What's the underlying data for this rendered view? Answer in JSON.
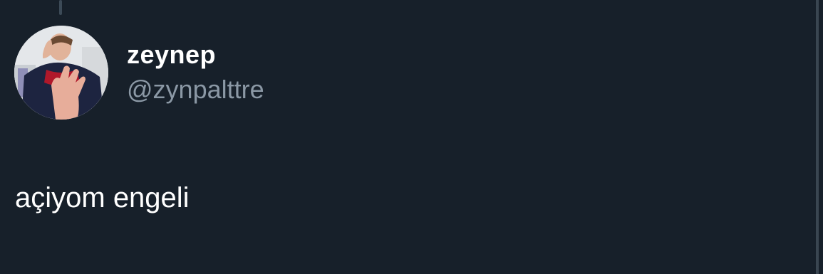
{
  "tweet": {
    "author": {
      "display_name": "zeynep",
      "handle": "@zynpalttre"
    },
    "text": "açiyom engeli"
  },
  "colors": {
    "background": "#17202a",
    "name_text": "#ffffff",
    "handle_text": "#8b98a5",
    "thread_line": "#3c4a57"
  }
}
